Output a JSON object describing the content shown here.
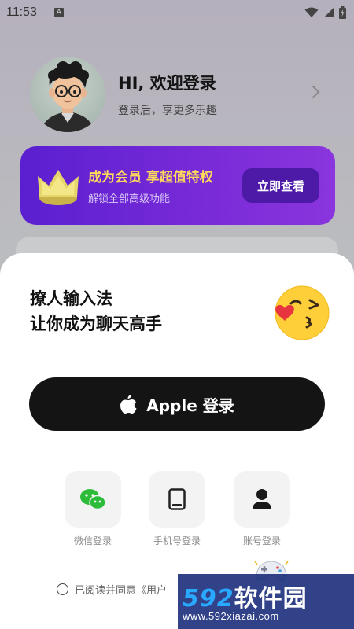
{
  "status": {
    "time": "11:53",
    "a_badge": "A"
  },
  "profile": {
    "title": "HI, 欢迎登录",
    "subtitle": "登录后，享更多乐趣"
  },
  "vip": {
    "title": "成为会员 享超值特权",
    "subtitle": "解锁全部高级功能",
    "button": "立即查看"
  },
  "sheet": {
    "title_line1": "撩人输入法",
    "title_line2": "让你成为聊天高手",
    "apple_button": "Apple 登录",
    "options": [
      {
        "label": "微信登录",
        "icon": "wechat-icon"
      },
      {
        "label": "手机号登录",
        "icon": "phone-icon"
      },
      {
        "label": "账号登录",
        "icon": "user-icon"
      }
    ],
    "agreement": "已阅读并同意《用户"
  },
  "watermark": {
    "brand_num": "592",
    "brand_text": "软件园",
    "url": "www.592xiazai.com"
  },
  "colors": {
    "vip_bg": "#6a25d4",
    "vip_title": "#ffd95a",
    "wechat": "#2dbb3a",
    "apple_btn": "#141414"
  }
}
